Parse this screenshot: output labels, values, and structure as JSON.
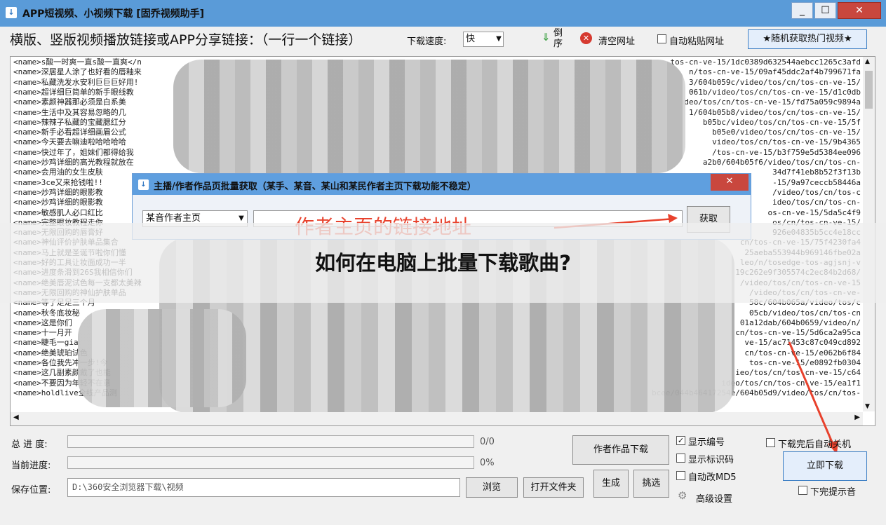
{
  "window": {
    "title": "APP短视频、小视频下载 [固乔视频助手]",
    "icon": "app-icon",
    "min_glyph": "_",
    "max_glyph": "☐",
    "close_glyph": "✕"
  },
  "toolbar": {
    "instruction": "横版、竖版视频播放链接或APP分享链接：（一行一个链接）",
    "speed_label": "下载速度:",
    "speed_value": "快",
    "sort_label": "倒序",
    "clear_label": "清空网址",
    "autopaste_label": "自动粘贴网址",
    "random_hot_label": "★随机获取热门视频★"
  },
  "links": {
    "left": [
      "<name>s酸一时爽一直s酸一直爽</n",
      "<name>深居星人涂了也好看的唇釉来",
      "<name>私藏洗发水安利巨巨巨好用!",
      "<name>超详细巨简单的新手眼线教",
      "<name>素颜神器那必须是白系美",
      "<name>生活中及其容易忽略的几",
      "<name>辣辣子私藏的宝藏腮红分",
      "<name>新手必看超详细画眉公式",
      "<name>今天要去嘛迪啦哈哈哈哈",
      "<name>快过年了，姐妹们都得给我",
      "<name>炒鸡详细的高光教程就放在",
      "<name>会用油的女生皮肤",
      "<name>3ce又来抢钱啦!!",
      "<name>炒鸡详细的眼影教",
      "<name>炒鸡详细的眼影教",
      "<name>敏感肌人必口红比",
      "<name>完整眼妆教程走你",
      "<name>无限回购的唇膏好",
      "<name>神仙评价护肤单品集合",
      "<name>马上就是圣诞节啦你们懂",
      "<name>好的工具让妆面成功一半",
      "<name>进度条滑到26S我相信你们",
      "<name>绝美唇泥试色每一支都太美辣",
      "<name>无限回购的神仙护肤单品",
      "<name>等了足足三个月",
      "<name>秋冬底妆秘",
      "<name>这是你们",
      "<name>十一月开",
      "<name>睫毛一gia",
      "<name>绝美琥珀试色",
      "<name>各位我先冲一步!今",
      "<name>这几副素颜戴了也能",
      "<name>不要因为年轻不在意",
      "<name>holdlive全线产品测"
    ],
    "right": [
      "tos-cn-ve-15/1dc0389d632544aebcc1265c3afd",
      "n/tos-cn-ve-15/09af45ddc2af4b799671fa",
      "3/604b059c/video/tos/cn/tos-cn-ve-15/",
      "061b/video/tos/cn/tos-cn-ve-15/d1c0db",
      "deo/tos/cn/tos-cn-ve-15/fd75a059c9894a",
      "1/604b05b8/video/tos/cn/tos-cn-ve-15/",
      "b05bc/video/tos/cn/tos-cn-ve-15/5f",
      "b05e0/video/tos/cn/tos-cn-ve-15/",
      "video/tos/cn/tos-cn-ve-15/9b4365",
      "/tos-cn-ve-15/b3f759e5d5384ee096",
      "a2b0/604b05f6/video/tos/cn/tos-cn-",
      "34d7f41eb8b52f3f13b",
      "-15/9a97ceccb58446a",
      "/video/tos/cn/tos-c",
      "ideo/tos/cn/tos-cn-",
      "os-cn-ve-15/5da5c4f9",
      "os/cn/tos-cn-ve-15/",
      "926e04835b5cc4e18cc",
      "cn/tos-cn-ve-15/75f4230fa4",
      "25aeba553944b969146fbe02a",
      "leo/n/tosedge-tos-agjsnj-v",
      "19c262e9f305574c2ec84b2d68/",
      "/video/tos/cn/tos-cn-ve-15",
      "/video/tos/cn/tos-cn-ve-",
      "58c/604b065a/video/tos/c",
      "05cb/video/tos/cn/tos-cn",
      "01a12dab/604b0659/video/n/",
      "cn/tos-cn-ve-15/5d6ca2a95ca",
      "ve-15/ac71453c87c049cd892",
      "cn/tos-cn-ve-15/e062b6f84",
      "tos-cn-ve-15/e0892fb0304",
      "ieo/tos/cn/tos-cn-ve-15/c64",
      "ideo/tos/cn/tos-cn-ve-15/ea1f1",
      "bcee/044b46417254e/604b05d9/video/tos/cn/tos-"
    ]
  },
  "dialog": {
    "title": "主播/作者作品页批量获取（某手、某音、某山和某民作者主页下载功能不稳定）",
    "close_glyph": "✕",
    "select_value": "某音作者主页",
    "get_label": "获取",
    "annotation": "作者主页的链接地址"
  },
  "banner": {
    "text": "如何在电脑上批量下载歌曲?"
  },
  "bottom": {
    "total_progress_label": "总 进 度:",
    "total_progress_value": "0/0",
    "total_progress_fraction": 0,
    "current_progress_label": "当前进度:",
    "current_progress_value": "0%",
    "current_progress_fraction": 0,
    "save_label": "保存位置:",
    "save_path": "D:\\360安全浏览器下载\\视频",
    "browse_label": "浏览",
    "open_folder_label": "打开文件夹",
    "author_download_label": "作者作品下载",
    "generate_label": "生成",
    "pick_label": "挑选",
    "show_number_label": "显示编号",
    "show_number_checked": true,
    "show_id_label": "显示标识码",
    "auto_md5_label": "自动改MD5",
    "advanced_label": "高级设置",
    "shutdown_label": "下载完后自动关机",
    "download_now_label": "立即下载",
    "notify_label": "下完提示音"
  },
  "colors": {
    "title_bar": "#5a9bd8",
    "close_red": "#c9473e",
    "annotation_red": "#e8412c"
  }
}
